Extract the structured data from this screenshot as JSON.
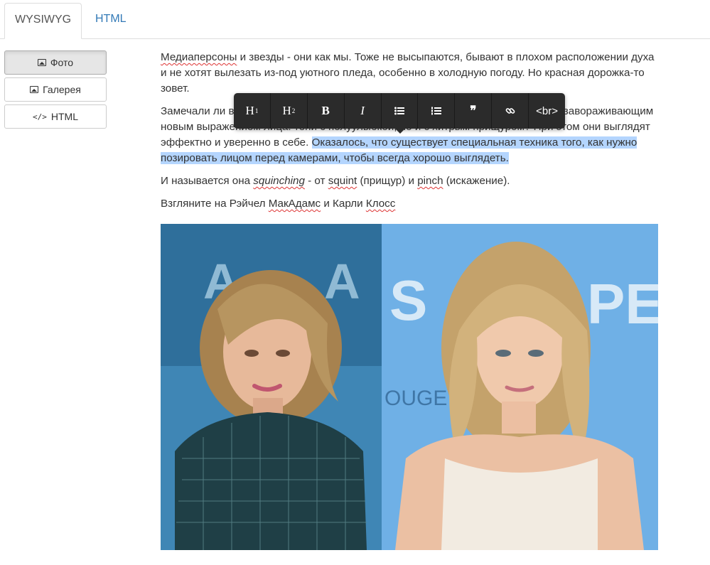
{
  "tabs": [
    {
      "label": "WYSIWYG",
      "active": true
    },
    {
      "label": "HTML",
      "active": false
    }
  ],
  "sidebar": {
    "buttons": [
      {
        "label": "Фото",
        "icon": "image-icon",
        "active": true
      },
      {
        "label": "Галерея",
        "icon": "image-icon",
        "active": false
      },
      {
        "label": "HTML",
        "icon": "code-icon",
        "active": false
      }
    ]
  },
  "toolbar": {
    "h1": "H",
    "h2": "H",
    "h1_sup": "1",
    "h2_sup": "2",
    "bold": "B",
    "italic": "I",
    "ul_icon": "bullet-list-icon",
    "ol_icon": "numbered-list-icon",
    "quote": "❞",
    "link_icon": "link-icon",
    "br": "<br>"
  },
  "content": {
    "p1_a": "Медиаперсоны",
    "p1_b": " и звезды - они как мы. Тоже не высыпаются, бывают в плохом расположении духа и не хотят вылезать из-под уютного пледа, особенно в холодную погоду. Но красная дорожка-то зовет.",
    "p2_a": "Замечали ли вы, что звезды часто фотографируются с несколько странным, но завораживающим новым выражением лица: тени с полуулыбкой, но и с хитрым прищуром? При этом они выглядят эффектно и уверенно в себе. ",
    "p2_sel": "Оказалось, что существует специальная техника того, как нужно позировать лицом перед камерами, чтобы всегда хорошо выглядеть.",
    "p3_a": "И называется она ",
    "p3_term": "squinching",
    "p3_b": " - от ",
    "p3_w1": "squint",
    "p3_c": " (прищур) и ",
    "p3_w2": "pinch",
    "p3_d": " (искажение).",
    "p4_a": "Взгляните на Рэйчел ",
    "p4_w1": "МакАдамс",
    "p4_b": " и Карли ",
    "p4_w2": "Клосс"
  },
  "colors": {
    "accent": "#337ab7",
    "selection": "#b4d5fe",
    "toolbar": "#2b2b2b"
  }
}
